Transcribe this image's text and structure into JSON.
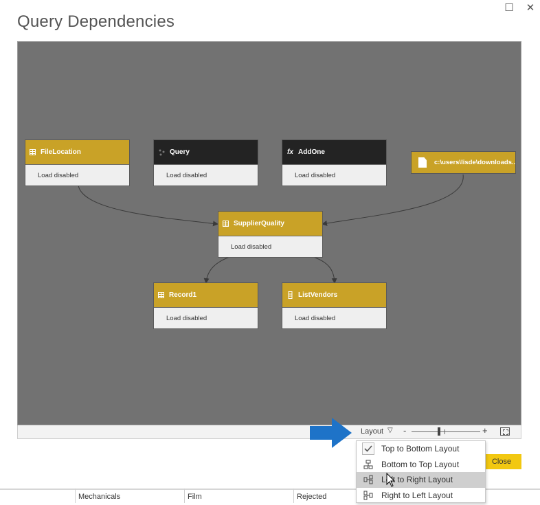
{
  "window": {
    "title": "Query Dependencies",
    "maximize_glyph": "☐",
    "close_glyph": "✕"
  },
  "nodes": [
    {
      "id": "filelocation",
      "name": "FileLocation",
      "status": "Load disabled",
      "header_color": "#c9a227",
      "icon": "table-icon"
    },
    {
      "id": "query",
      "name": "Query",
      "status": "Load disabled",
      "header_color": "#232323",
      "icon": "query-icon"
    },
    {
      "id": "addone",
      "name": "AddOne",
      "status": "Load disabled",
      "header_color": "#232323",
      "icon": "function-icon",
      "icon_glyph": "fx"
    },
    {
      "id": "supplierquality",
      "name": "SupplierQuality",
      "status": "Load disabled",
      "header_color": "#c9a227",
      "icon": "table-icon"
    },
    {
      "id": "record1",
      "name": "Record1",
      "status": "Load disabled",
      "header_color": "#c9a227",
      "icon": "table-icon"
    },
    {
      "id": "listvendors",
      "name": "ListVendors",
      "status": "Load disabled",
      "header_color": "#c9a227",
      "icon": "list-icon"
    }
  ],
  "file_source": {
    "path": "c:\\users\\lisde\\downloads...",
    "icon": "file-icon",
    "color": "#c9a227"
  },
  "edges": [
    {
      "from": "filelocation",
      "to": "supplierquality"
    },
    {
      "from": "file_source",
      "to": "supplierquality"
    },
    {
      "from": "supplierquality",
      "to": "record1"
    },
    {
      "from": "supplierquality",
      "to": "listvendors"
    }
  ],
  "statusbar": {
    "layout_label": "Layout",
    "layout_caret": "▽",
    "zoom_minus": "-",
    "zoom_plus": "+",
    "zoom_level": 0.4
  },
  "layout_menu": {
    "items": [
      {
        "label": "Top to Bottom Layout",
        "icon": "checkmark-icon",
        "checked": true
      },
      {
        "label": "Bottom to Top Layout",
        "icon": "bottom-to-top-icon"
      },
      {
        "label": "Left to Right Layout",
        "icon": "left-to-right-icon",
        "highlighted": true
      },
      {
        "label": "Right to Left Layout",
        "icon": "right-to-left-icon"
      }
    ]
  },
  "close_button": {
    "label": "Close",
    "color": "#f2c811"
  },
  "background_table": {
    "cells": [
      "Mechanicals",
      "Film",
      "Rejected"
    ]
  },
  "colors": {
    "accent_gold": "#c9a227",
    "canvas_bg": "#727272",
    "pointer_arrow": "#1e73c8"
  }
}
